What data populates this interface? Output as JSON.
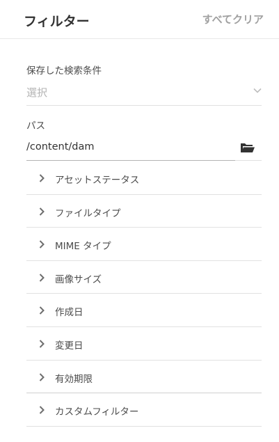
{
  "header": {
    "title": "フィルター",
    "clear_all": "すべてクリア"
  },
  "saved_search": {
    "label": "保存した検索条件",
    "value": "選択"
  },
  "path": {
    "label": "パス",
    "value": "/content/dam"
  },
  "accordion": {
    "items": [
      {
        "label": "アセットステータス"
      },
      {
        "label": "ファイルタイプ"
      },
      {
        "label": "MIME タイプ"
      },
      {
        "label": "画像サイズ"
      },
      {
        "label": "作成日"
      },
      {
        "label": "変更日"
      },
      {
        "label": "有効期限"
      },
      {
        "label": "カスタムフィルター"
      }
    ]
  },
  "colors": {
    "text": "#323232",
    "muted": "#a0a0a0",
    "placeholder": "#b3b3b3",
    "divider": "#e1e1e1"
  }
}
